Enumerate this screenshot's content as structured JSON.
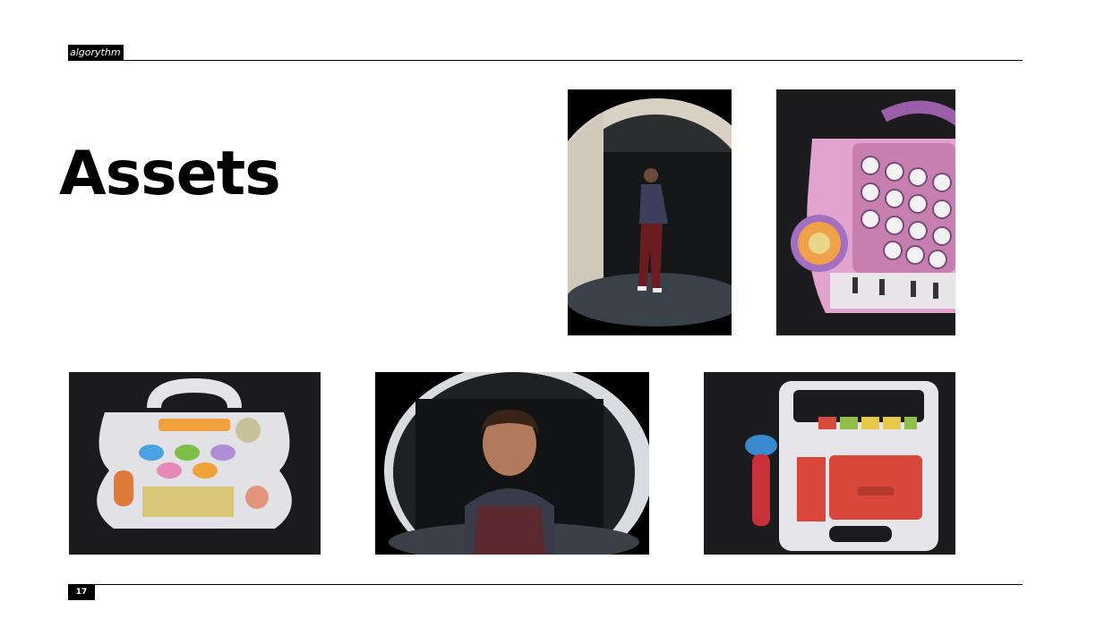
{
  "header": {
    "brand": "algorythm"
  },
  "slide": {
    "title": "Assets",
    "page_number": "17"
  },
  "photos": [
    {
      "name": "fisheye-full-body-portrait",
      "icon": "person-standing-photo"
    },
    {
      "name": "pink-alphabet-toy",
      "icon": "toy-keyboard-photo"
    },
    {
      "name": "white-animal-sound-toy",
      "icon": "toy-keyboard-photo"
    },
    {
      "name": "fisheye-closeup-portrait",
      "icon": "person-portrait-photo"
    },
    {
      "name": "toy-cassette-player",
      "icon": "cassette-player-photo"
    }
  ],
  "colors": {
    "ink": "#000000",
    "background": "#ffffff",
    "photo_bg": "#1a1a1a"
  }
}
